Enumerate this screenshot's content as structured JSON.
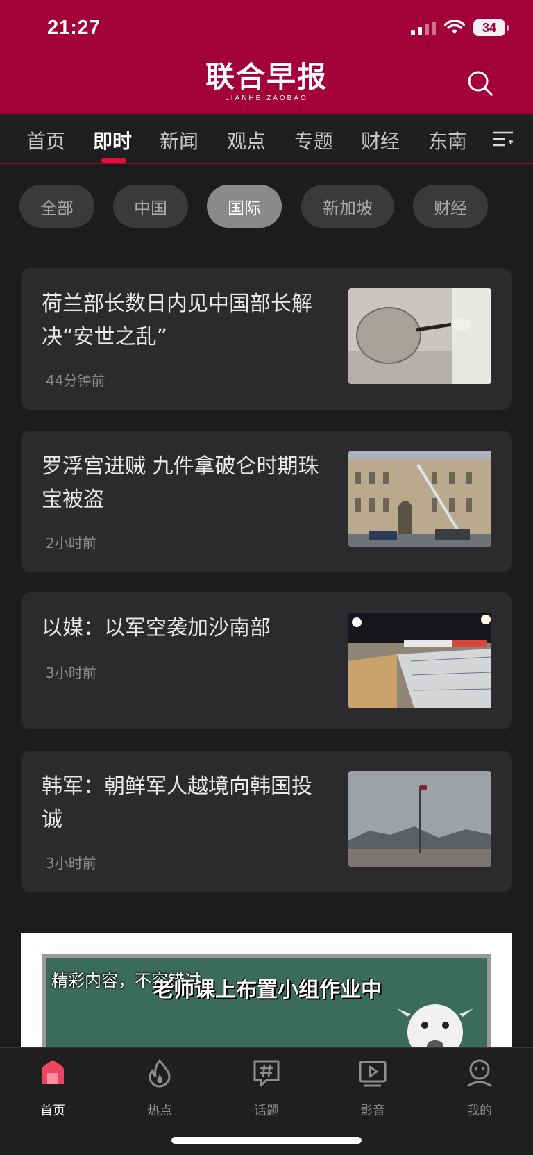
{
  "status_bar": {
    "time": "21:27",
    "battery": "34"
  },
  "header": {
    "logo": "联合早报",
    "logo_sub": "LIANHE ZAOBAO",
    "search_icon": "search-icon",
    "brand_color": "#a3003a"
  },
  "channels": {
    "tabs": [
      {
        "label": "首页"
      },
      {
        "label": "即时",
        "active": true
      },
      {
        "label": "新闻"
      },
      {
        "label": "观点"
      },
      {
        "label": "专题"
      },
      {
        "label": "财经"
      },
      {
        "label": "东南"
      }
    ],
    "menu_icon": "channel-menu-icon"
  },
  "filters": {
    "chips": [
      {
        "label": "全部"
      },
      {
        "label": "中国"
      },
      {
        "label": "国际",
        "active": true
      },
      {
        "label": "新加坡"
      },
      {
        "label": "财经"
      }
    ]
  },
  "articles": [
    {
      "title": "荷兰部长数日内见中国部长解决“安世之乱”",
      "time": "44分钟前",
      "image": "semiconductor-wafer-photo"
    },
    {
      "title": "罗浮宫进贼 九件拿破仑时期珠宝被盗",
      "time": "2小时前",
      "image": "louvre-crane-photo"
    },
    {
      "title": "以媒：以军空袭加沙南部",
      "time": "3小时前",
      "image": "aid-trucks-photo"
    },
    {
      "title": "韩军：朝鲜军人越境向韩国投诚",
      "time": "3小时前",
      "image": "border-flagpole-photo"
    }
  ],
  "ad": {
    "caption": "精彩内容，不容错过",
    "headline": "老师课上布置小组作业中"
  },
  "bottom_nav": {
    "items": [
      {
        "label": "首页",
        "icon": "home-icon",
        "active": true
      },
      {
        "label": "热点",
        "icon": "flame-icon"
      },
      {
        "label": "话题",
        "icon": "hashtag-icon"
      },
      {
        "label": "影音",
        "icon": "video-play-icon"
      },
      {
        "label": "我的",
        "icon": "profile-icon"
      }
    ]
  }
}
